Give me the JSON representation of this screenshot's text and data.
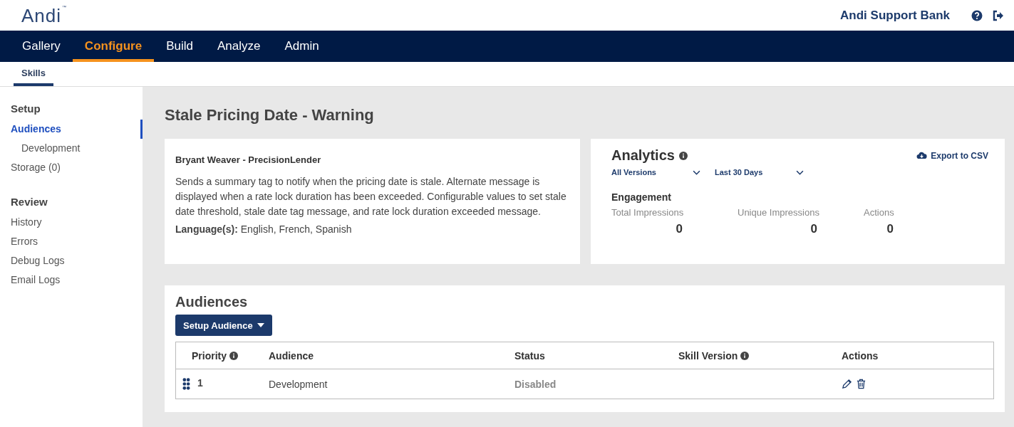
{
  "header": {
    "logo": "Andi",
    "trademark": "™",
    "org_name": "Andi Support Bank"
  },
  "nav": [
    {
      "label": "Gallery",
      "selected": false
    },
    {
      "label": "Configure",
      "selected": true
    },
    {
      "label": "Build",
      "selected": false
    },
    {
      "label": "Analyze",
      "selected": false
    },
    {
      "label": "Admin",
      "selected": false
    }
  ],
  "subnav": [
    {
      "label": "Skills",
      "selected": true
    }
  ],
  "sidebar": {
    "sections": [
      {
        "title": "Setup",
        "items": [
          {
            "label": "Audiences",
            "selected": true,
            "children": [
              {
                "label": "Development",
                "selected": false
              }
            ]
          },
          {
            "label": "Storage (0)",
            "selected": false
          }
        ]
      },
      {
        "title": "Review",
        "items": [
          {
            "label": "History",
            "selected": false
          },
          {
            "label": "Errors",
            "selected": false
          },
          {
            "label": "Debug Logs",
            "selected": false
          },
          {
            "label": "Email Logs",
            "selected": false
          }
        ]
      }
    ]
  },
  "page_title": "Stale Pricing Date - Warning",
  "skill": {
    "author": "Bryant Weaver - PrecisionLender",
    "description": "Sends a summary tag to notify when the pricing date is stale. Alternate message is displayed when a rate lock duration has been exceeded. Configurable values to set stale date threshold, stale date tag message, and rate lock duration exceeded message.",
    "languages": "**Language(s):** English, French, Spanish"
  },
  "analytics": {
    "title": "Analytics",
    "export": "Export to CSV",
    "filters": [
      "All Versions",
      "Last 30 Days"
    ],
    "section": "Engagement",
    "metrics": [
      {
        "label": "Total Impressions",
        "value": "0"
      },
      {
        "label": "Unique Impressions",
        "value": "0"
      },
      {
        "label": "Actions",
        "value": "0"
      }
    ]
  },
  "audiences": {
    "title": "Audiences",
    "button": "Setup Audience",
    "columns": [
      {
        "label": "Priority",
        "info": true
      },
      {
        "label": "Audience",
        "info": false
      },
      {
        "label": "Status",
        "info": false
      },
      {
        "label": "Skill Version",
        "info": true
      },
      {
        "label": "Actions",
        "info": false
      }
    ],
    "rows": [
      {
        "priority": "1",
        "audience": "Development",
        "status": "Disabled",
        "disabled": true
      }
    ]
  }
}
